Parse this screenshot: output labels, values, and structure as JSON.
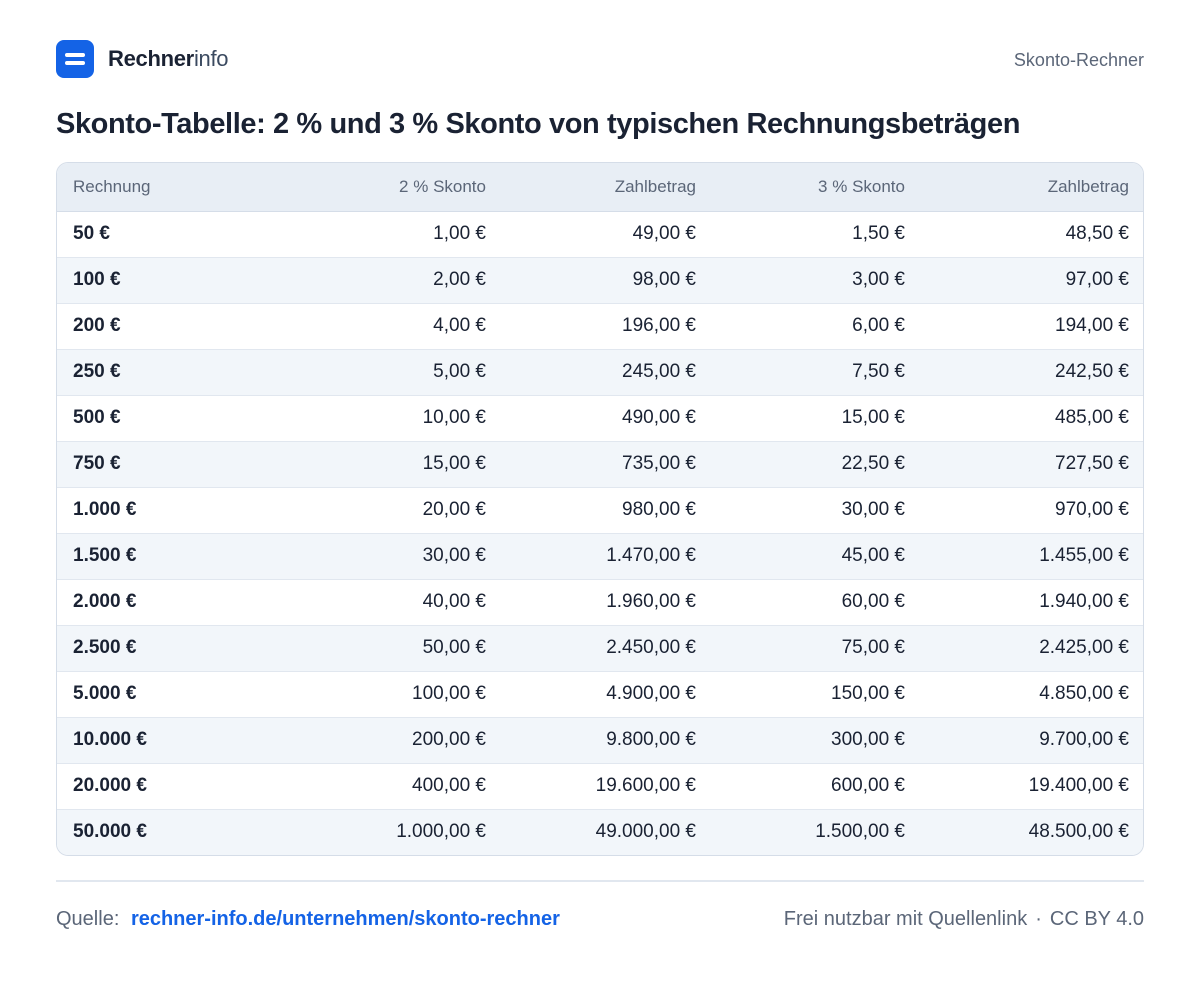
{
  "header": {
    "brand_strong": "Rechner",
    "brand_light": "info",
    "right_label": "Skonto-Rechner"
  },
  "title": "Skonto-Tabelle:  2 % und 3 % Skonto von typischen Rechnungsbeträgen",
  "table": {
    "columns": [
      "Rechnung",
      "2 % Skonto",
      "Zahlbetrag",
      "3 % Skonto",
      "Zahlbetrag"
    ],
    "rows": [
      [
        "50 €",
        "1,00 €",
        "49,00 €",
        "1,50 €",
        "48,50 €"
      ],
      [
        "100 €",
        "2,00 €",
        "98,00 €",
        "3,00 €",
        "97,00 €"
      ],
      [
        "200 €",
        "4,00 €",
        "196,00 €",
        "6,00 €",
        "194,00 €"
      ],
      [
        "250 €",
        "5,00 €",
        "245,00 €",
        "7,50 €",
        "242,50 €"
      ],
      [
        "500 €",
        "10,00 €",
        "490,00 €",
        "15,00 €",
        "485,00 €"
      ],
      [
        "750 €",
        "15,00 €",
        "735,00 €",
        "22,50 €",
        "727,50 €"
      ],
      [
        "1.000 €",
        "20,00 €",
        "980,00 €",
        "30,00 €",
        "970,00 €"
      ],
      [
        "1.500 €",
        "30,00 €",
        "1.470,00 €",
        "45,00 €",
        "1.455,00 €"
      ],
      [
        "2.000 €",
        "40,00 €",
        "1.960,00 €",
        "60,00 €",
        "1.940,00 €"
      ],
      [
        "2.500 €",
        "50,00 €",
        "2.450,00 €",
        "75,00 €",
        "2.425,00 €"
      ],
      [
        "5.000 €",
        "100,00 €",
        "4.900,00 €",
        "150,00 €",
        "4.850,00 €"
      ],
      [
        "10.000 €",
        "200,00 €",
        "9.800,00 €",
        "300,00 €",
        "9.700,00 €"
      ],
      [
        "20.000 €",
        "400,00 €",
        "19.600,00 €",
        "600,00 €",
        "19.400,00 €"
      ],
      [
        "50.000 €",
        "1.000,00 €",
        "49.000,00 €",
        "1.500,00 €",
        "48.500,00 €"
      ]
    ]
  },
  "footer": {
    "source_label": "Quelle:",
    "source_link": "rechner-info.de/unternehmen/skonto-rechner",
    "license_text": "Frei nutzbar mit Quellenlink",
    "separator": "·",
    "license": "CC BY 4.0"
  },
  "colors": {
    "accent": "#1463e6",
    "text": "#1a2233",
    "muted": "#5b6678",
    "header_bg": "#e8eef5",
    "stripe_bg": "#f2f6fa"
  }
}
